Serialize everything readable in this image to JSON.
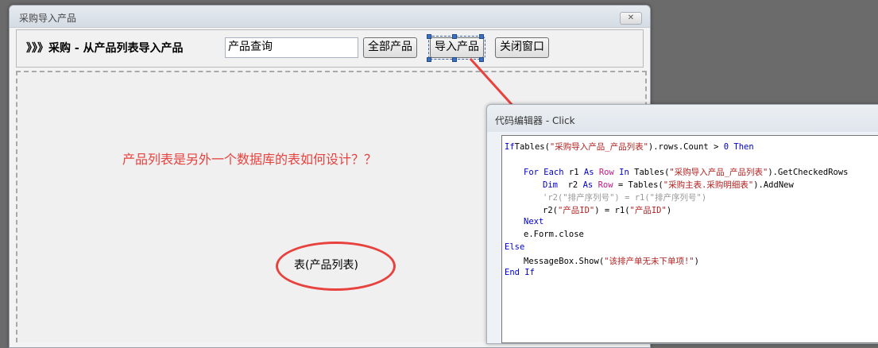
{
  "main_window": {
    "title": "采购导入产品",
    "close_glyph": "✕",
    "heading": "》》》采购 - 从产品列表导入产品",
    "search_value": "产品查询",
    "buttons": {
      "all_products": "全部产品",
      "import_products": "导入产品",
      "close_window": "关闭窗口"
    },
    "question_text": "产品列表是另外一个数据库的表如何设计？？",
    "table_label": "表(产品列表)"
  },
  "code_window": {
    "title": "代码编辑器 - Click"
  },
  "code_lines": [
    {
      "indent": 0,
      "tokens": [
        [
          "kw",
          "If"
        ],
        [
          "",
          "Tables("
        ],
        [
          "str",
          "\"采购导入产品_产品列表\""
        ],
        [
          "",
          ").rows.Count > "
        ],
        [
          "kw",
          "0"
        ],
        [
          "",
          ""
        ],
        [
          "kw",
          " Then"
        ]
      ]
    },
    {
      "indent": 0,
      "tokens": []
    },
    {
      "indent": 1,
      "tokens": [
        [
          "kw",
          "For Each"
        ],
        [
          "",
          " r1 "
        ],
        [
          "kw",
          "As"
        ],
        [
          "",
          " "
        ],
        [
          "ty",
          "Row"
        ],
        [
          "",
          " "
        ],
        [
          "kw",
          "In"
        ],
        [
          "",
          " Tables("
        ],
        [
          "str",
          "\"采购导入产品_产品列表\""
        ],
        [
          "",
          ").GetCheckedRows"
        ]
      ]
    },
    {
      "indent": 2,
      "tokens": [
        [
          "kw",
          "Dim"
        ],
        [
          "",
          "  r2 "
        ],
        [
          "kw",
          "As"
        ],
        [
          "",
          " "
        ],
        [
          "ty",
          "Row"
        ],
        [
          "",
          " = Tables("
        ],
        [
          "str",
          "\"采购主表.采购明细表\""
        ],
        [
          "",
          ").AddNew"
        ]
      ]
    },
    {
      "indent": 2,
      "tokens": [
        [
          "cm",
          "'r2(\"排产序列号\") = r1(\"排产序列号\")"
        ]
      ]
    },
    {
      "indent": 2,
      "tokens": [
        [
          "",
          "r2("
        ],
        [
          "str",
          "\"产品ID\""
        ],
        [
          "",
          ") = r1("
        ],
        [
          "str",
          "\"产品ID\""
        ],
        [
          "",
          ")"
        ]
      ]
    },
    {
      "indent": 1,
      "tokens": [
        [
          "kw",
          "Next"
        ]
      ]
    },
    {
      "indent": 1,
      "tokens": [
        [
          "",
          "e.Form.close"
        ]
      ]
    },
    {
      "indent": 0,
      "tokens": [
        [
          "kw",
          "Else"
        ]
      ]
    },
    {
      "indent": 1,
      "tokens": [
        [
          "",
          "MessageBox.Show("
        ],
        [
          "str",
          "\"该排产单无未下单项!\""
        ],
        [
          "",
          ")"
        ]
      ]
    },
    {
      "indent": 0,
      "tokens": [
        [
          "kw",
          "End If"
        ]
      ]
    }
  ],
  "colors": {
    "annotation_red": "#e8423f",
    "keyword_blue": "#0000c8",
    "type_magenta": "#c71585",
    "string_red": "#b22222",
    "comment_gray": "#999999"
  }
}
